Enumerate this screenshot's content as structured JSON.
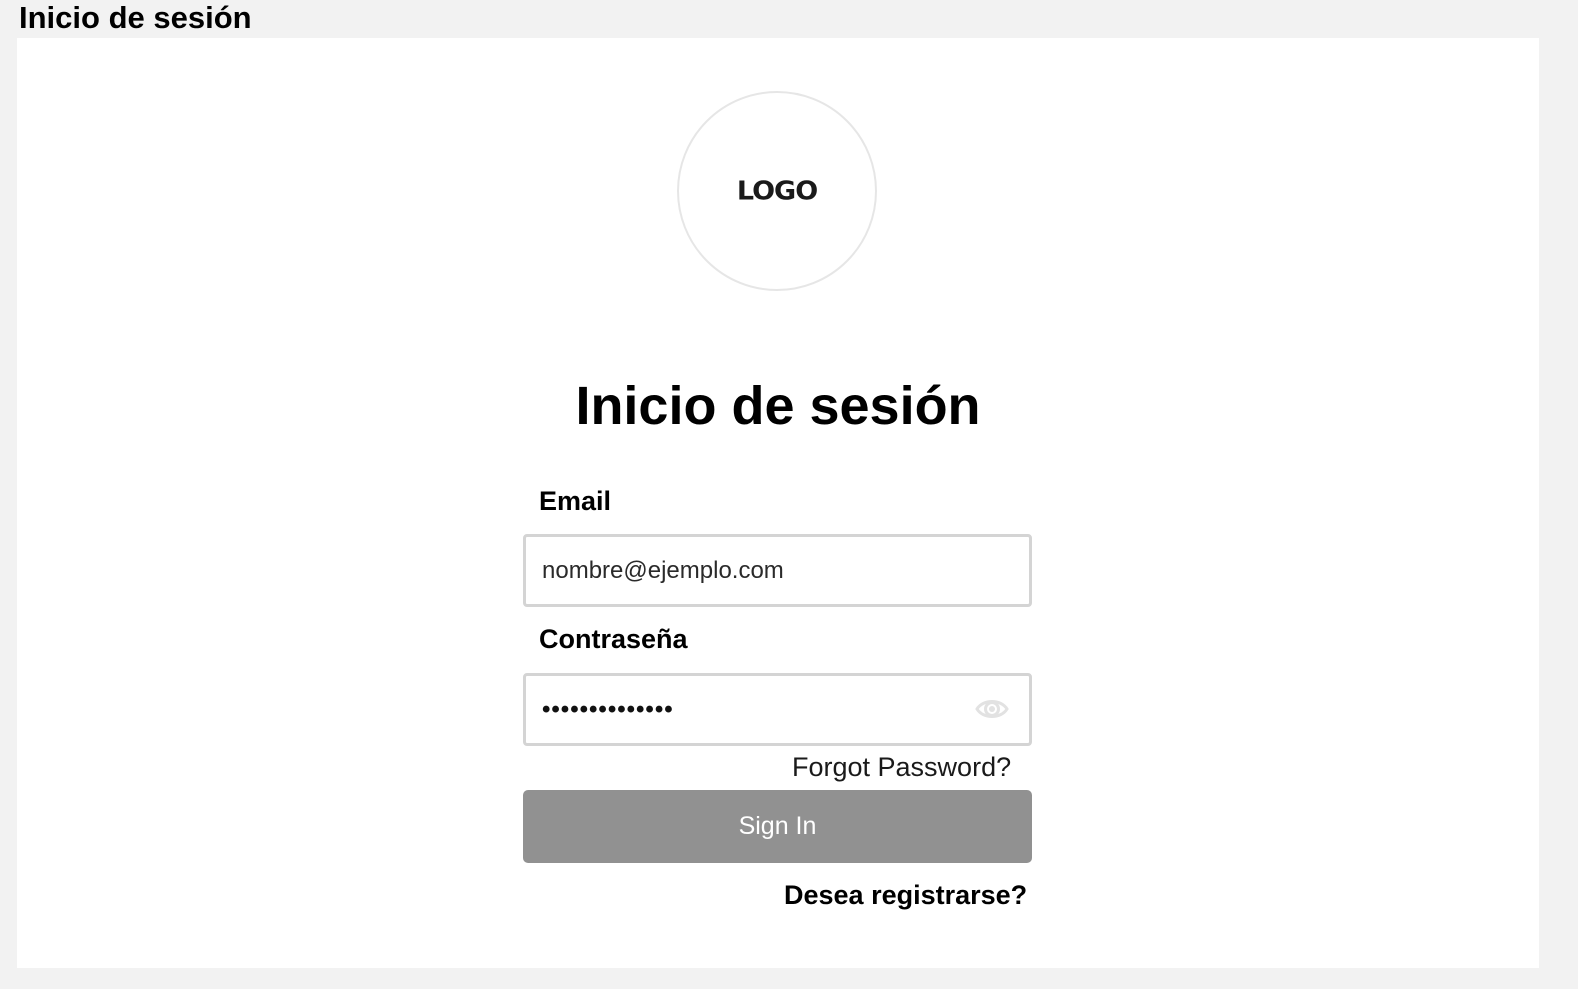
{
  "frame": {
    "title": "Inicio de sesión"
  },
  "logo": {
    "text": "LOGO"
  },
  "form": {
    "title": "Inicio de sesión",
    "email": {
      "label": "Email",
      "value": "nombre@ejemplo.com"
    },
    "password": {
      "label": "Contraseña",
      "value": "••••••••••••••",
      "toggle_icon": "eye-icon"
    },
    "forgot_password": "Forgot Password?",
    "submit_label": "Sign In",
    "register_link": "Desea registrarse?"
  },
  "colors": {
    "background": "#f2f2f2",
    "card": "#ffffff",
    "button": "#919191",
    "input_border": "#d4d4d4"
  }
}
